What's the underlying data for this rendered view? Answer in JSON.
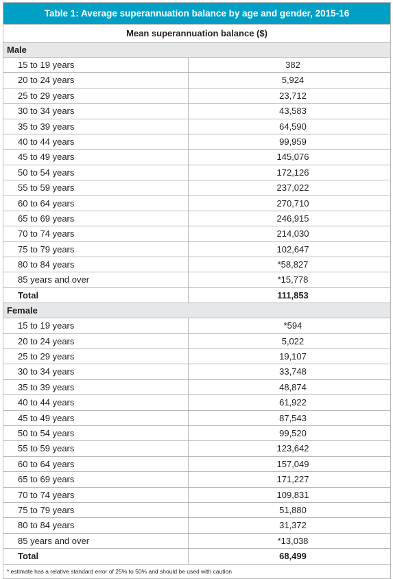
{
  "table": {
    "title": "Table 1: Average superannuation balance by age and gender, 2015-16",
    "column_header": "Mean superannuation balance ($)",
    "groups": [
      {
        "label": "Male",
        "rows": [
          {
            "age": "15 to 19 years",
            "value": "382"
          },
          {
            "age": "20 to 24 years",
            "value": "5,924"
          },
          {
            "age": "25 to 29 years",
            "value": "23,712"
          },
          {
            "age": "30 to 34 years",
            "value": "43,583"
          },
          {
            "age": "35 to 39 years",
            "value": "64,590"
          },
          {
            "age": "40 to 44 years",
            "value": "99,959"
          },
          {
            "age": "45 to 49 years",
            "value": "145,076"
          },
          {
            "age": "50 to 54 years",
            "value": "172,126"
          },
          {
            "age": "55 to 59 years",
            "value": "237,022"
          },
          {
            "age": "60 to 64 years",
            "value": "270,710"
          },
          {
            "age": "65 to 69 years",
            "value": "246,915"
          },
          {
            "age": "70 to 74 years",
            "value": "214,030"
          },
          {
            "age": "75 to 79 years",
            "value": "102,647"
          },
          {
            "age": "80 to 84 years",
            "value": "*58,827"
          },
          {
            "age": "85 years and over",
            "value": "*15,778"
          }
        ],
        "total_label": "Total",
        "total_value": "111,853"
      },
      {
        "label": "Female",
        "rows": [
          {
            "age": "15 to 19 years",
            "value": "*594"
          },
          {
            "age": "20 to 24 years",
            "value": "5,022"
          },
          {
            "age": "25 to 29 years",
            "value": "19,107"
          },
          {
            "age": "30 to 34 years",
            "value": "33,748"
          },
          {
            "age": "35 to 39 years",
            "value": "48,874"
          },
          {
            "age": "40 to 44 years",
            "value": "61,922"
          },
          {
            "age": "45 to 49 years",
            "value": "87,543"
          },
          {
            "age": "50 to 54 years",
            "value": "99,520"
          },
          {
            "age": "55 to 59 years",
            "value": "123,642"
          },
          {
            "age": "60 to 64 years",
            "value": "157,049"
          },
          {
            "age": "65 to 69 years",
            "value": "171,227"
          },
          {
            "age": "70 to 74 years",
            "value": "109,831"
          },
          {
            "age": "75 to 79 years",
            "value": "51,880"
          },
          {
            "age": "80 to 84 years",
            "value": "31,372"
          },
          {
            "age": "85 years and over",
            "value": "*13,038"
          }
        ],
        "total_label": "Total",
        "total_value": "68,499"
      }
    ],
    "footnote": "*  estimate has a relative standard error of 25% to 50% and should be used with caution"
  },
  "colors": {
    "title_background": "#00a0c6",
    "group_background": "#e6e7e8",
    "border": "#b8b8b8"
  }
}
